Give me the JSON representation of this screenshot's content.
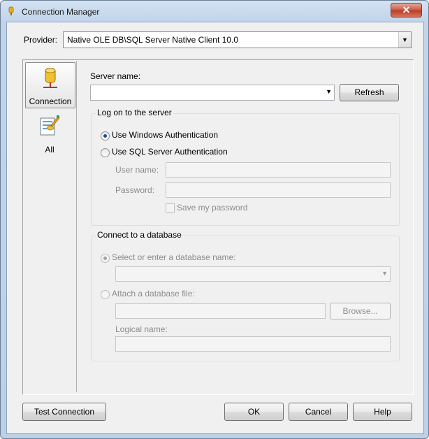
{
  "window": {
    "title": "Connection Manager",
    "close_glyph": "✕"
  },
  "provider": {
    "label": "Provider:",
    "value": "Native OLE DB\\SQL Server Native Client 10.0"
  },
  "nav": {
    "items": [
      {
        "label": "Connection",
        "icon": "database-icon"
      },
      {
        "label": "All",
        "icon": "properties-icon"
      }
    ]
  },
  "server": {
    "label": "Server name:",
    "value": "",
    "refresh_label": "Refresh"
  },
  "logon": {
    "legend": "Log on to the server",
    "windows_auth": "Use Windows Authentication",
    "sql_auth": "Use SQL Server Authentication",
    "user_label": "User name:",
    "password_label": "Password:",
    "save_password": "Save my password",
    "selected": "windows"
  },
  "database": {
    "legend": "Connect to a database",
    "select_option": "Select or enter a database name:",
    "attach_option": "Attach a database file:",
    "browse_label": "Browse...",
    "logical_label": "Logical name:"
  },
  "footer": {
    "test_label": "Test Connection",
    "ok_label": "OK",
    "cancel_label": "Cancel",
    "help_label": "Help"
  }
}
